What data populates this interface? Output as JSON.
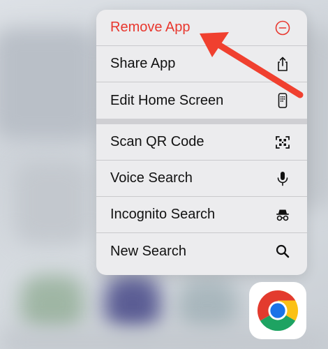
{
  "menu": {
    "items": [
      {
        "label": "Remove App",
        "icon": "minus-circle-icon",
        "destructive": true
      },
      {
        "label": "Share App",
        "icon": "share-icon"
      },
      {
        "label": "Edit Home Screen",
        "icon": "phone-icon"
      },
      {
        "label": "Scan QR Code",
        "icon": "qr-scan-icon"
      },
      {
        "label": "Voice Search",
        "icon": "microphone-icon"
      },
      {
        "label": "Incognito Search",
        "icon": "incognito-icon"
      },
      {
        "label": "New Search",
        "icon": "search-icon"
      }
    ]
  },
  "app": {
    "icon": "chrome-icon"
  },
  "colors": {
    "destructive": "#e8372e",
    "arrow": "#f0402f"
  }
}
